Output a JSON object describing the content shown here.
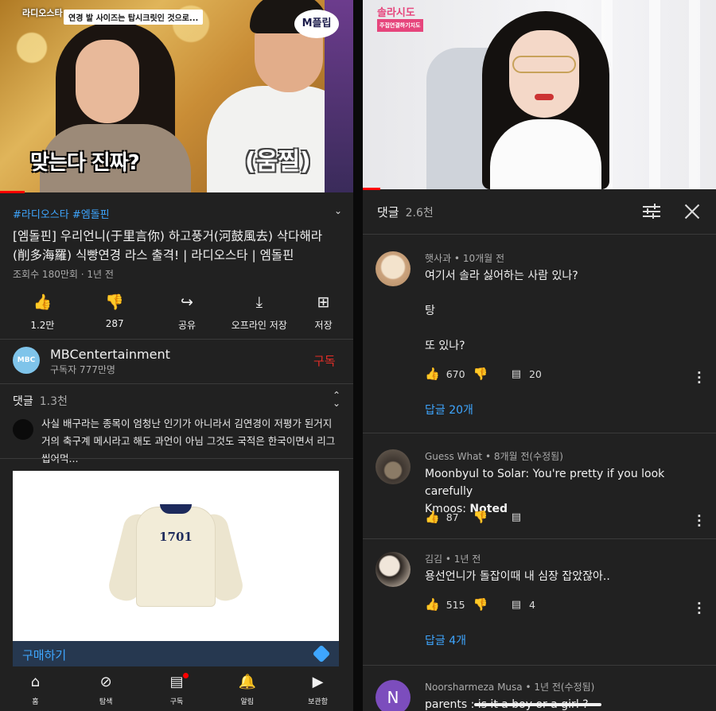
{
  "left": {
    "video": {
      "logo": "라디오스타",
      "top_caption": "연경 발 사이즈는 탑시크릿인 것으로...",
      "channel_logo": "M플립",
      "subtitle_left": "맞는다 진짜?",
      "subtitle_right": "(움찔)",
      "progress_fraction": 0.07
    },
    "tags": "#라디오스타 #엠돌핀",
    "title": "[엠돌핀] 우리언니(于里言你) 하고풍거(河鼓風去) 삭다해라(削多海羅) 식빵연경 라스 출격! | 라디오스타 | 엠돌핀",
    "meta": "조회수 180만회 · 1년 전",
    "actions": [
      {
        "icon": "thumbs-up-icon",
        "glyph": "👍",
        "label": "1.2만"
      },
      {
        "icon": "thumbs-down-icon",
        "glyph": "👎",
        "label": "287"
      },
      {
        "icon": "share-icon",
        "glyph": "↪",
        "label": "공유"
      },
      {
        "icon": "download-icon",
        "glyph": "⤓",
        "label": "오프라인 저장"
      },
      {
        "icon": "save-icon",
        "glyph": "⊞",
        "label": "저장"
      }
    ],
    "channel": {
      "avatar_text": "MBC",
      "name": "MBCentertainment",
      "subscribers": "구독자 777만명",
      "subscribe_label": "구독"
    },
    "comments": {
      "label": "댓글",
      "count": "1.3천",
      "preview": "사실 배구라는 종목이 엄청난 인기가 아니라서 김연경이 저평가 된거지 거의 축구계 메시라고 해도 과언이 아님 그것도 국적은 한국이면서 리그 씹어먹..."
    },
    "ad": {
      "print_text": "1701",
      "buy_label": "구매하기"
    },
    "nav": [
      {
        "icon": "home-icon",
        "glyph": "⌂",
        "label": "홈"
      },
      {
        "icon": "explore-icon",
        "glyph": "⊘",
        "label": "탐색"
      },
      {
        "icon": "subscriptions-icon",
        "glyph": "▤",
        "label": "구독"
      },
      {
        "icon": "bell-icon",
        "glyph": "🔔",
        "label": "알림"
      },
      {
        "icon": "library-icon",
        "glyph": "▶",
        "label": "보관함"
      }
    ]
  },
  "right": {
    "video": {
      "logo": "솔라시도",
      "logo_sub": "주접연결하기지도",
      "progress_fraction": 0.05
    },
    "comments_header": {
      "label": "댓글",
      "count": "2.6천"
    },
    "comments": [
      {
        "author": "햇사과 • 10개월 전",
        "text": "여기서 솔라 싫어하는 사람 있나?\n\n탕\n\n또 있나?",
        "likes": "670",
        "replies_count": "20",
        "replies_label": "답글 20개",
        "avatar_color": "#d9c2a6"
      },
      {
        "author": "Guess What • 8개월 전(수정됨)",
        "text_line1": "Moonbyul to Solar: You're pretty if you look carefully",
        "text_line2_prefix": "Kmoos: ",
        "text_line2_bold": "Noted",
        "likes": "87",
        "replies_count": "",
        "avatar_color": "#5b5249"
      },
      {
        "author": "김김 • 1년 전",
        "text": "용선언니가 돌잡이때 내 심장 잡았잖아..",
        "likes": "515",
        "replies_count": "4",
        "replies_label": "답글 4개",
        "avatar_color": "#e9dcd0"
      },
      {
        "author": "Noorsharmeza Musa • 1년 전(수정됨)",
        "text": "parents : is it a boy or a girl ?",
        "avatar_letter": "N",
        "avatar_color": "#7c4dbd"
      }
    ]
  }
}
